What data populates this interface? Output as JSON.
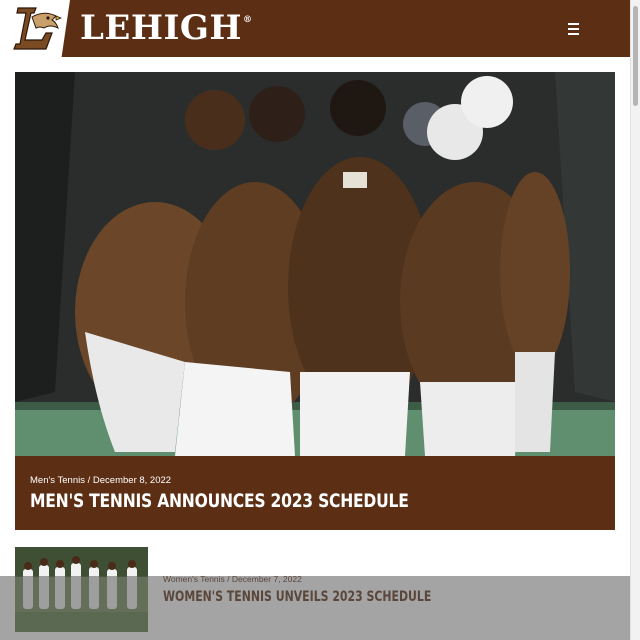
{
  "header": {
    "brand": "LEHIGH",
    "trademark": "®",
    "logo": "lehigh-mountain-hawk-l-logo",
    "menu_icon": "hamburger-menu-icon",
    "bg_color": "#5c2f14"
  },
  "hero_story": {
    "category": "Men's Tennis",
    "date": "December 8, 2022",
    "separator": " / ",
    "title": "MEN'S TENNIS ANNOUNCES 2023 SCHEDULE",
    "image": "mens-tennis-team-huddle-photo"
  },
  "stories": [
    {
      "category": "Women's Tennis",
      "date": "December 7, 2022",
      "separator": " / ",
      "title": "WOMEN'S TENNIS UNVEILS 2023 SCHEDULE",
      "image": "womens-tennis-team-photo"
    }
  ],
  "colors": {
    "brand_brown": "#5c2f14",
    "white": "#ffffff"
  }
}
